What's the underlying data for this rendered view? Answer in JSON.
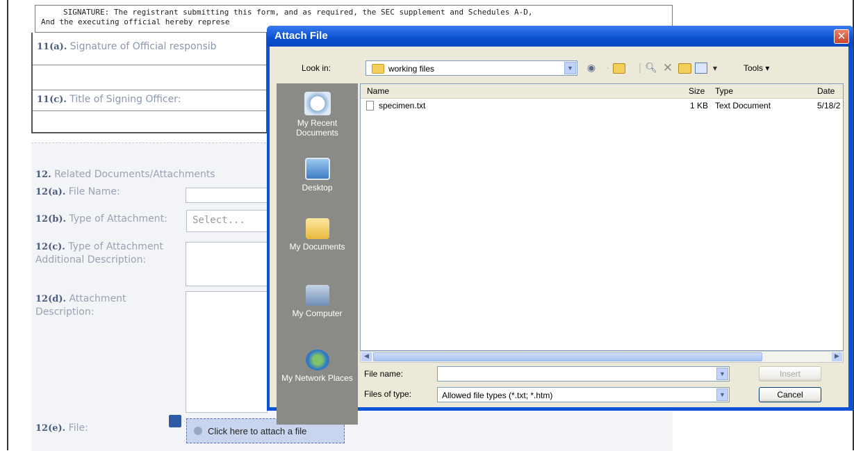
{
  "form": {
    "signature_line1": "SIGNATURE: The registrant submitting this form, and as required, the SEC supplement and Schedules A-D,",
    "signature_line2": "And the executing official hereby represe",
    "row_11a_num": "11(a).",
    "row_11a_label": "Signature of Official responsib",
    "row_11c_num": "11(c).",
    "row_11c_label": "Title of Signing Officer:",
    "section12_num": "12.",
    "section12_label": "Related Documents/Attachments",
    "f12a_num": "12(a).",
    "f12a_label": "File Name:",
    "f12b_num": "12(b).",
    "f12b_label": "Type of Attachment:",
    "f12b_value": "Select...",
    "f12c_num": "12(c).",
    "f12c_label": "Type of Attachment Additional Description:",
    "f12d_num": "12(d).",
    "f12d_label": "Attachment Description:",
    "f12e_num": "12(e).",
    "f12e_label": "File:",
    "attach_button": "Click here to attach a file"
  },
  "dialog": {
    "title": "Attach File",
    "close_glyph": "✕",
    "look_in_label": "Look in:",
    "look_in_value": "working files",
    "tools_label": "Tools",
    "places": [
      "My Recent Documents",
      "Desktop",
      "My Documents",
      "My Computer",
      "My Network Places"
    ],
    "columns": [
      "Name",
      "Size",
      "Type",
      "Date"
    ],
    "files": [
      {
        "name": "specimen.txt",
        "size": "1 KB",
        "type": "Text Document",
        "date": "5/18/2"
      }
    ],
    "file_name_label": "File name:",
    "file_name_value": "",
    "files_of_type_label": "Files of type:",
    "files_of_type_value": "Allowed file types (*.txt; *.htm)",
    "insert_label": "Insert",
    "cancel_label": "Cancel"
  },
  "colors": {
    "dialog_blue": "#0a52d6",
    "xp_face": "#ece9d8",
    "places_bar": "#8a8a86",
    "form_label": "#9aa2b3"
  },
  "icons": [
    "folder-icon",
    "back-icon",
    "up-folder-icon",
    "search-web-icon",
    "delete-icon",
    "new-folder-icon",
    "views-icon",
    "recent-documents-icon",
    "desktop-icon",
    "my-documents-icon",
    "my-computer-icon",
    "network-places-icon",
    "text-file-icon",
    "paperclip-icon"
  ]
}
